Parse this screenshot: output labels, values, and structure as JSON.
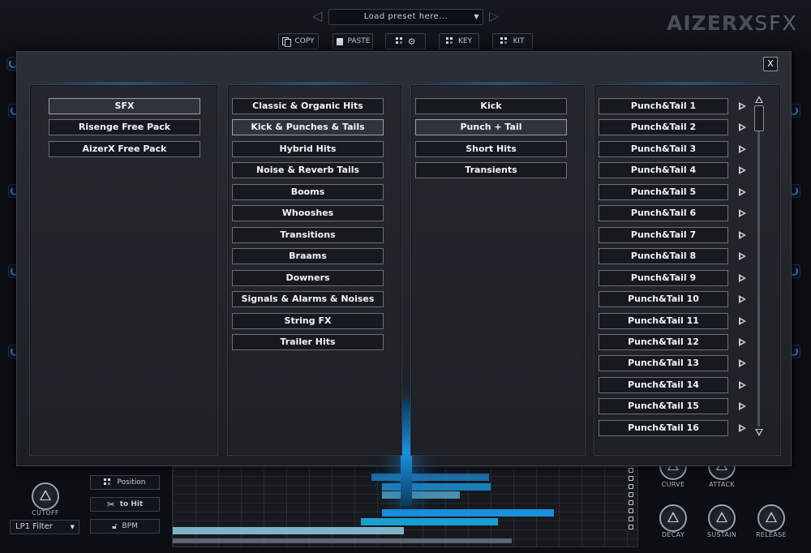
{
  "header": {
    "preset_placeholder": "Load preset here...",
    "logo_bold": "AIZERX",
    "logo_light": "SFX",
    "buttons": {
      "copy": "COPY",
      "paste": "PASTE",
      "key": "KEY",
      "kit": "KIT"
    }
  },
  "modal": {
    "close_label": "X",
    "libraries": [
      {
        "label": "SFX",
        "selected": true
      },
      {
        "label": "Risenge Free Pack",
        "selected": false
      },
      {
        "label": "AizerX Free Pack",
        "selected": false
      }
    ],
    "categories": [
      {
        "label": "Classic & Organic Hits",
        "selected": false
      },
      {
        "label": "Kick & Punches & Tails",
        "selected": true
      },
      {
        "label": "Hybrid Hits",
        "selected": false
      },
      {
        "label": "Noise & Reverb Tails",
        "selected": false
      },
      {
        "label": "Booms",
        "selected": false
      },
      {
        "label": "Whooshes",
        "selected": false
      },
      {
        "label": "Transitions",
        "selected": false
      },
      {
        "label": "Braams",
        "selected": false
      },
      {
        "label": "Downers",
        "selected": false
      },
      {
        "label": "Signals & Alarms & Noises",
        "selected": false
      },
      {
        "label": "String FX",
        "selected": false
      },
      {
        "label": "Trailer Hits",
        "selected": false
      }
    ],
    "subcategories": [
      {
        "label": "Kick",
        "selected": false
      },
      {
        "label": "Punch + Tail",
        "selected": true
      },
      {
        "label": "Short Hits",
        "selected": false
      },
      {
        "label": "Transients",
        "selected": false
      }
    ],
    "sounds": [
      "Punch&Tail 1",
      "Punch&Tail 2",
      "Punch&Tail 3",
      "Punch&Tail 4",
      "Punch&Tail 5",
      "Punch&Tail 6",
      "Punch&Tail 7",
      "Punch&Tail 8",
      "Punch&Tail 9",
      "Punch&Tail 10",
      "Punch&Tail 11",
      "Punch&Tail 12",
      "Punch&Tail 13",
      "Punch&Tail 14",
      "Punch&Tail 15",
      "Punch&Tail 16"
    ]
  },
  "bottom": {
    "cutoff_label": "CUTOFF",
    "filter_value": "LP1 Filter",
    "position_label": "Position",
    "to_hit_label": "to Hit",
    "bpm_label": "BPM",
    "envelope": {
      "curve": "CURVE",
      "attack": "ATTACK",
      "decay": "DECAY",
      "sustain": "SUSTAIN",
      "release": "RELEASE"
    }
  },
  "colors": {
    "accent": "#1b8fe0",
    "bar_blue": "#1c7fb8",
    "bar_light": "#7fb3c9"
  }
}
